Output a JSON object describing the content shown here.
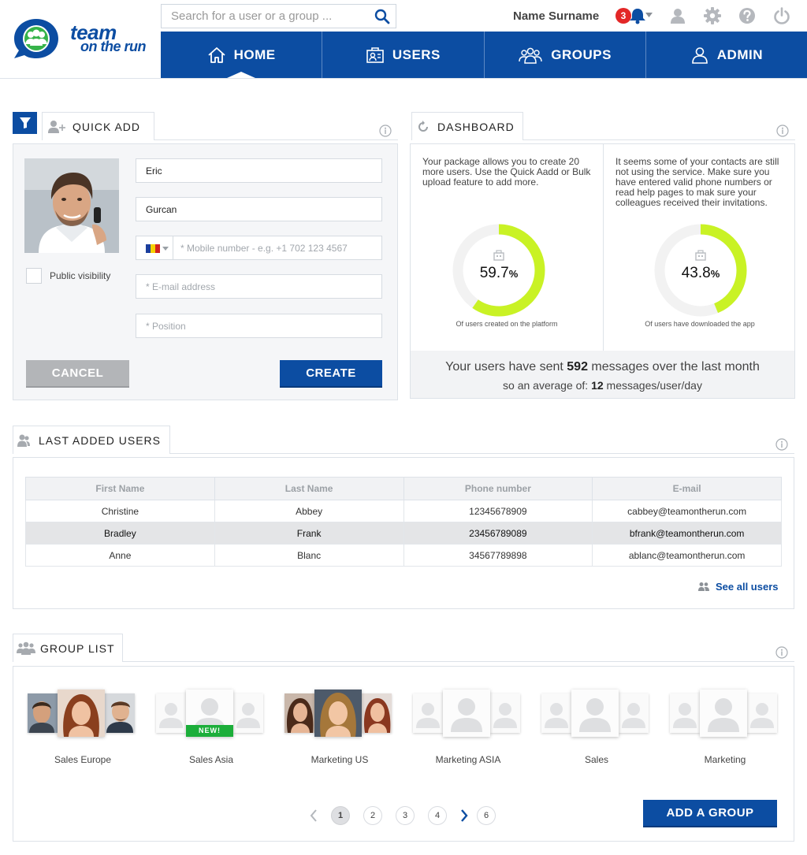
{
  "brand": {
    "line1": "team",
    "line2": "on the run"
  },
  "search": {
    "placeholder": "Search for a user or a group ..."
  },
  "user": {
    "name": "Name Surname",
    "notifications": "3"
  },
  "nav": {
    "home": "HOME",
    "users": "USERS",
    "groups": "GROUPS",
    "admin": "ADMIN"
  },
  "quick_add": {
    "title": "QUICK ADD",
    "first_name": "Eric",
    "last_name": "Gurcan",
    "mobile_placeholder": "* Mobile number - e.g. +1 702 123 4567",
    "email_placeholder": "* E-mail address",
    "position_placeholder": "* Position",
    "public_visibility": "Public visibility",
    "cancel": "CANCEL",
    "create": "CREATE"
  },
  "dashboard": {
    "title": "DASHBOARD",
    "left_text": "Your package allows you to create 20 more users. Use the Quick Aadd or Bulk upload feature to add more.",
    "right_text": "It seems some of your contacts are still not using the service. Make sure you have entered valid phone numbers or read help pages to mak sure your colleagues received their invitations.",
    "stat1": {
      "value": "59.7",
      "fraction": 0.597,
      "unit": "%",
      "caption": "Of users created on the platform"
    },
    "stat2": {
      "value": "43.8",
      "fraction": 0.438,
      "unit": "%",
      "caption": "Of users have downloaded the app"
    },
    "footer_pre": "Your users have sent ",
    "footer_count": "592",
    "footer_post": " messages over the last month",
    "footer2_pre": "so an average of: ",
    "footer2_value": "12",
    "footer2_post": " messages/user/day",
    "colors": {
      "accent": "#c9f225",
      "track": "#f2f2f2"
    }
  },
  "last_users": {
    "title": "LAST ADDED USERS",
    "columns": [
      "First Name",
      "Last Name",
      "Phone number",
      "E-mail"
    ],
    "rows": [
      [
        "Christine",
        "Abbey",
        "12345678909",
        "cabbey@teamontherun.com"
      ],
      [
        "Bradley",
        "Frank",
        "23456789089",
        "bfrank@teamontherun.com"
      ],
      [
        "Anne",
        "Blanc",
        "34567789898",
        "ablanc@teamontherun.com"
      ]
    ],
    "see_all": "See all users"
  },
  "group_list": {
    "title": "GROUP LIST",
    "groups": [
      {
        "name": "Sales Europe"
      },
      {
        "name": "Sales Asia",
        "badge": "NEW!"
      },
      {
        "name": "Marketing US"
      },
      {
        "name": "Marketing ASIA"
      },
      {
        "name": "Sales"
      },
      {
        "name": "Marketing"
      }
    ],
    "pages": [
      "1",
      "2",
      "3",
      "4",
      "6"
    ],
    "add_group": "ADD A GROUP"
  },
  "colors": {
    "brand_blue": "#0c4da2",
    "badge_red": "#e32727",
    "new_green": "#1cae3a"
  }
}
